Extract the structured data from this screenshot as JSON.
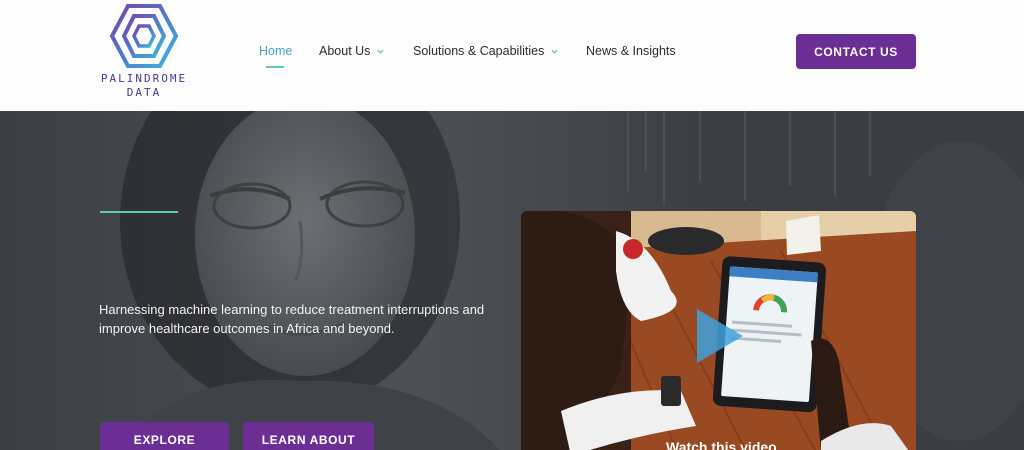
{
  "brand": {
    "name_line1": "PALINDROME",
    "name_line2": "DATA",
    "colors": {
      "primary": "#6a2e95",
      "accent": "#5cc9b0",
      "active_link": "#4aa0c8"
    }
  },
  "nav": {
    "items": [
      {
        "label": "Home",
        "active": true,
        "has_dropdown": false
      },
      {
        "label": "About Us",
        "active": false,
        "has_dropdown": true
      },
      {
        "label": "Solutions & Capabilities",
        "active": false,
        "has_dropdown": true
      },
      {
        "label": "News & Insights",
        "active": false,
        "has_dropdown": false
      }
    ],
    "dropdown_icon": "chevron-down-icon"
  },
  "header": {
    "contact_label": "CONTACT US"
  },
  "hero": {
    "tagline": "Harnessing machine learning to reduce treatment interruptions and improve healthcare outcomes in Africa and beyond.",
    "buttons": {
      "explore_label": "EXPLORE",
      "learn_label": "LEARN ABOUT"
    },
    "video": {
      "caption": "Watch this video",
      "play_icon": "play-icon"
    }
  }
}
